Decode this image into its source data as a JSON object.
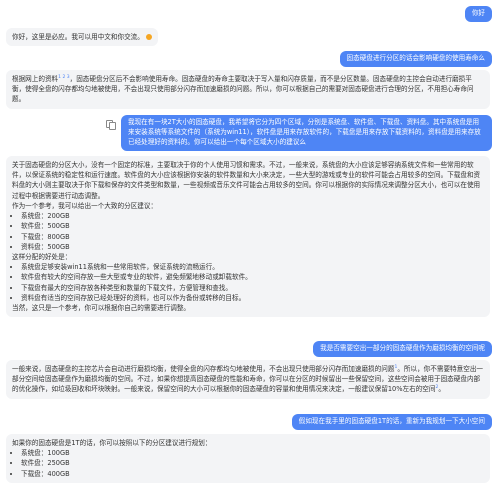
{
  "messages": {
    "m1": {
      "role": "user",
      "text": "你好"
    },
    "m2": {
      "role": "assistant",
      "text": "你好，这里是必应。我可以用中文和你交流。"
    },
    "m3": {
      "role": "user",
      "text": "固态硬盘进行分区的话会影响硬盘的使用寿命么"
    },
    "m4": {
      "role": "assistant",
      "text_a": "根据网上的资料",
      "refs": "1 2 3",
      "text_b": "，固态硬盘分区后不会影响使用寿命。固态硬盘的寿命主要取决于写入量和闪存质量，而不是分区数量。固态硬盘的主控会自动进行磨损平衡，使得全盘的闪存都均匀地被使用，不会出现只使用部分闪存而加速磨损的问题。所以，你可以根据自己的需要对固态硬盘进行合理的分区，不用担心寿命问题。"
    },
    "m5": {
      "role": "user",
      "text": "我现在有一块2T大小的固态硬盘，我希望将它分为四个区域，分别是系统盘、软件盘、下载盘、资料盘。其中系统盘是用来安装系统等系统文件的（系统为win11），软件盘是用来存放软件的，下载盘是用来存放下载资料的，资料盘是用来存放已经处理好的资料的。你可以给出一个每个区域大小的建议么"
    },
    "m6": {
      "role": "assistant",
      "intro": "关于固态硬盘的分区大小，没有一个固定的标准，主要取决于你的个人使用习惯和需求。不过，一般来说，系统盘的大小应该足够容纳系统文件和一些常用的软件，以保证系统的稳定性和运行速度。软件盘的大小应该根据你安装的软件数量和大小来决定，一些大型的游戏或专业的软件可能会占用较多的空间。下载盘和资料盘的大小则主要取决于你下载和保存的文件类型和数量，一些视频或音乐文件可能会占用较多的空间。你可以根据你的实际情况来调整分区大小，也可以在使用过程中根据需要进行动态调整。",
      "lead": "作为一个参考，我可以给出一个大致的分区建议：",
      "sizes": [
        "系统盘：200GB",
        "软件盘：500GB",
        "下载盘：800GB",
        "资料盘：500GB"
      ],
      "reasons_lead": "这样分配的好处是：",
      "reasons": [
        "系统盘足够安装win11系统和一些常用软件，保证系统的流畅运行。",
        "软件盘有较大的空间存放一些大型或专业的软件，避免频繁地移动或卸载软件。",
        "下载盘有最大的空间存放各种类型和数量的下载文件，方便管理和查找。",
        "资料盘有适当的空间存放已经处理好的资料，也可以作为备份或转移的目标。"
      ],
      "outro": "当然，这只是一个参考，你可以根据你自己的需要进行调整。"
    },
    "m7": {
      "role": "user",
      "text": "我是否需要空出一部分的固态硬盘作为磨损均衡的空间呢"
    },
    "m8": {
      "role": "assistant",
      "text_a": "一般来说，固态硬盘的主控芯片会自动进行磨损均衡，使得全盘的闪存都均匀地被使用，不会出现只使用部分闪存而加速磨损的问题",
      "refs": "1",
      "text_b": "。所以，你不需要特意空出一部分空间给固态硬盘作为磨损均衡的空间。不过，如果你想提高固态硬盘的性能和寿命，你可以在分区的时候留出一些保留空间，这些空间会被用于固态硬盘内部的优化操作，如垃圾回收和坏块映射。一般来说，保留空间的大小可以根据你的固态硬盘的容量和使用情况来决定，一般建议保留10%左右的空间",
      "refs2": "2"
    },
    "m9": {
      "role": "user",
      "text": "假如现在我手里的固态硬盘1T的话，重新为我规划一下大小空间"
    },
    "m10": {
      "role": "assistant",
      "intro": "如果你的固态硬盘是1T的话，你可以按照以下的分区建议进行规划：",
      "sizes": [
        "系统盘：100GB",
        "软件盘：250GB",
        "下载盘：400GB"
      ]
    }
  },
  "colors": {
    "user_bubble": "#4e85f5",
    "bot_bubble": "#f3f4f6"
  },
  "icons": {
    "copy": "copy-icon",
    "avatar": "user-avatar"
  },
  "avatar_label": "我"
}
